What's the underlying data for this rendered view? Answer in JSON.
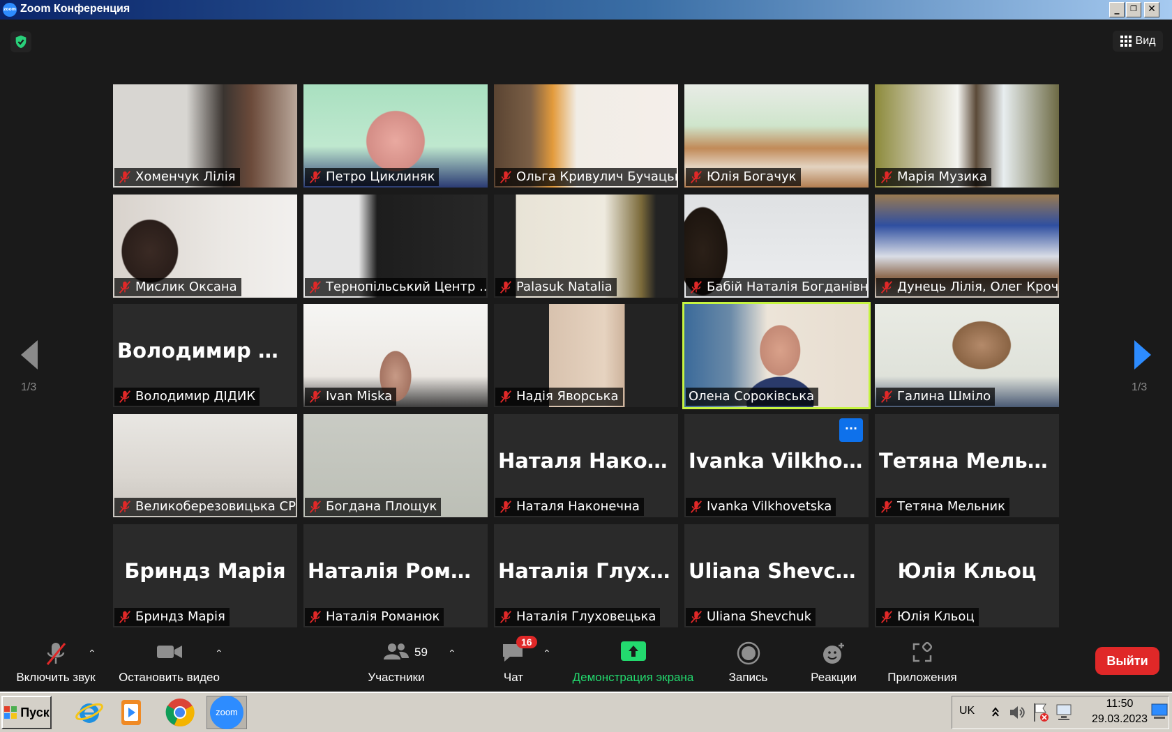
{
  "window": {
    "title": "Zoom Конференция",
    "app_logo_text": "zoom"
  },
  "top": {
    "view_label": "Вид"
  },
  "pager": {
    "left": "1/3",
    "right": "1/3"
  },
  "tiles": [
    {
      "label": "Хоменчук Лілія",
      "big": "",
      "video": "v1"
    },
    {
      "label": "Петро Циклиняк",
      "big": "",
      "video": "v2"
    },
    {
      "label": "Ольга Кривулич Бучацька...",
      "big": "",
      "video": "v3"
    },
    {
      "label": "Юлія Богачук",
      "big": "",
      "video": "v4"
    },
    {
      "label": "Марія Музика",
      "big": "",
      "video": "v5"
    },
    {
      "label": "Мислик Оксана",
      "big": "",
      "video": "v6"
    },
    {
      "label": "Тернопільський Центр ...",
      "big": "",
      "video": "v7"
    },
    {
      "label": "Palasuk Natalia",
      "big": "",
      "video": "v8"
    },
    {
      "label": "Бабій Наталія Богданівна",
      "big": "",
      "video": "v9"
    },
    {
      "label": "Дунець Лілія, Олег Кроч...",
      "big": "",
      "video": "v10"
    },
    {
      "label": "Володимир ДІДИК",
      "big": "Володимир  ДІ...",
      "video": ""
    },
    {
      "label": "Ivan Miska",
      "big": "",
      "video": "v12"
    },
    {
      "label": "Надія Яворська",
      "big": "",
      "video": "v13"
    },
    {
      "label": "Олена Сороківська",
      "big": "",
      "video": "v14",
      "active": true
    },
    {
      "label": "Галина Шміло",
      "big": "",
      "video": "v15"
    },
    {
      "label": "Великоберезовицька СР",
      "big": "",
      "video": "v16"
    },
    {
      "label": "Богдана Площук",
      "big": "",
      "video": "v17"
    },
    {
      "label": "Наталя Наконечна",
      "big": "Наталя  Наконе...",
      "video": ""
    },
    {
      "label": "Ivanka Vilkhovetska",
      "big": "Ivanka  Vilkhove...",
      "video": "",
      "more": "···"
    },
    {
      "label": "Тетяна Мельник",
      "big": "Тетяна Мельник",
      "video": ""
    },
    {
      "label": "Бриндз Марія",
      "big": "Бриндз Марія",
      "video": ""
    },
    {
      "label": "Наталія Романюк",
      "big": "Наталія  Роман...",
      "video": ""
    },
    {
      "label": "Наталія Глуховецька",
      "big": "Наталія  Глухов...",
      "video": ""
    },
    {
      "label": "Uliana Shevchuk",
      "big": "Uliana Shevchuk",
      "video": ""
    },
    {
      "label": "Юлія Кльоц",
      "big": "Юлія Кльоц",
      "video": ""
    }
  ],
  "toolbar": {
    "unmute": "Включить звук",
    "stop_video": "Остановить видео",
    "participants": "Участники",
    "participants_count": "59",
    "chat": "Чат",
    "chat_badge": "16",
    "share": "Демонстрация экрана",
    "record": "Запись",
    "reactions": "Реакции",
    "apps": "Приложения",
    "leave": "Выйти"
  },
  "colors": {
    "accent_green": "#29d07a",
    "share_green": "#23d96e",
    "leave_red": "#e02828",
    "active_border": "#c6f441",
    "badge_red": "#e02828",
    "arrow_blue": "#2d8cff"
  },
  "taskbar": {
    "start": "Пуск",
    "lang": "UK",
    "time": "11:50",
    "date": "29.03.2023",
    "apps": [
      "internet-explorer-icon",
      "media-player-icon",
      "chrome-icon",
      "zoom-icon"
    ],
    "zoom_text": "zoom"
  }
}
